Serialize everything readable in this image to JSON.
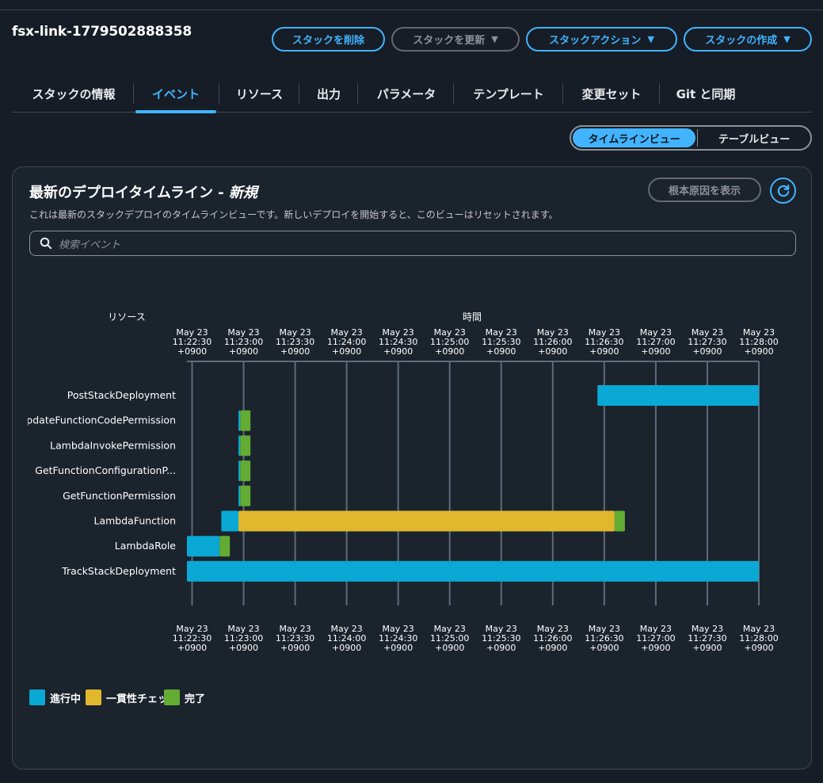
{
  "stack": {
    "name": "fsx-link-1779502888358"
  },
  "actions": {
    "delete": "スタックを削除",
    "update": "スタックを更新",
    "stack_actions": "スタックアクション",
    "create": "スタックの作成"
  },
  "tabs": [
    {
      "label": "スタックの情報",
      "active": false
    },
    {
      "label": "イベント",
      "active": true
    },
    {
      "label": "リソース",
      "active": false
    },
    {
      "label": "出力",
      "active": false
    },
    {
      "label": "パラメータ",
      "active": false
    },
    {
      "label": "テンプレート",
      "active": false
    },
    {
      "label": "変更セット",
      "active": false
    },
    {
      "label": "Git と同期",
      "active": false
    }
  ],
  "view_toggle": {
    "timeline": "タイムラインビュー",
    "table": "テーブルビュー",
    "selected": "timeline"
  },
  "panel": {
    "title": "最新のデプロイタイムライン - ",
    "title_em": "新規",
    "description": "これは最新のスタックデプロイのタイムラインビューです。新しいデプロイを開始すると、このビューはリセットされます。",
    "root_cause_button": "根本原因を表示",
    "search_placeholder": "検索イベント"
  },
  "colors": {
    "accent": "#42b4ff",
    "in_progress": "#0aa8d4",
    "consistency_check": "#e0b72d",
    "complete": "#62ac33"
  },
  "chart_data": {
    "type": "gantt",
    "resource_header": "リソース",
    "time_header": "時間",
    "x_ticks": [
      [
        "May 23",
        "11:22:30",
        "+0900"
      ],
      [
        "May 23",
        "11:23:00",
        "+0900"
      ],
      [
        "May 23",
        "11:23:30",
        "+0900"
      ],
      [
        "May 23",
        "11:24:00",
        "+0900"
      ],
      [
        "May 23",
        "11:24:30",
        "+0900"
      ],
      [
        "May 23",
        "11:25:00",
        "+0900"
      ],
      [
        "May 23",
        "11:25:30",
        "+0900"
      ],
      [
        "May 23",
        "11:26:00",
        "+0900"
      ],
      [
        "May 23",
        "11:26:30",
        "+0900"
      ],
      [
        "May 23",
        "11:27:00",
        "+0900"
      ],
      [
        "May 23",
        "11:27:30",
        "+0900"
      ],
      [
        "May 23",
        "11:28:00",
        "+0900"
      ]
    ],
    "x_range": [
      "11:22:27",
      "11:28:00"
    ],
    "resources": [
      {
        "label": "PostStackDeployment",
        "segments": [
          {
            "state": "進行中",
            "start": "11:26:26",
            "end": "11:28:00"
          }
        ]
      },
      {
        "label": "UpdateFunctionCodePermission",
        "segments": [
          {
            "state": "進行中",
            "start": "11:22:57",
            "end": "11:22:58"
          },
          {
            "state": "完了",
            "start": "11:22:58",
            "end": "11:23:04"
          }
        ]
      },
      {
        "label": "LambdaInvokePermission",
        "segments": [
          {
            "state": "進行中",
            "start": "11:22:57",
            "end": "11:22:58"
          },
          {
            "state": "完了",
            "start": "11:22:58",
            "end": "11:23:04"
          }
        ]
      },
      {
        "label": "GetFunctionConfigurationP...",
        "segments": [
          {
            "state": "進行中",
            "start": "11:22:57",
            "end": "11:22:58"
          },
          {
            "state": "完了",
            "start": "11:22:58",
            "end": "11:23:04"
          }
        ]
      },
      {
        "label": "GetFunctionPermission",
        "segments": [
          {
            "state": "進行中",
            "start": "11:22:57",
            "end": "11:22:58"
          },
          {
            "state": "完了",
            "start": "11:22:58",
            "end": "11:23:04"
          }
        ]
      },
      {
        "label": "LambdaFunction",
        "segments": [
          {
            "state": "進行中",
            "start": "11:22:47",
            "end": "11:22:57"
          },
          {
            "state": "一貫性チェック",
            "start": "11:22:57",
            "end": "11:26:36"
          },
          {
            "state": "完了",
            "start": "11:26:36",
            "end": "11:26:42"
          }
        ]
      },
      {
        "label": "LambdaRole",
        "segments": [
          {
            "state": "進行中",
            "start": "11:22:27",
            "end": "11:22:46"
          },
          {
            "state": "完了",
            "start": "11:22:46",
            "end": "11:22:52"
          }
        ]
      },
      {
        "label": "TrackStackDeployment",
        "segments": [
          {
            "state": "進行中",
            "start": "11:22:27",
            "end": "11:28:00"
          }
        ]
      }
    ],
    "legend": [
      "進行中",
      "一貫性チェック",
      "完了"
    ]
  }
}
